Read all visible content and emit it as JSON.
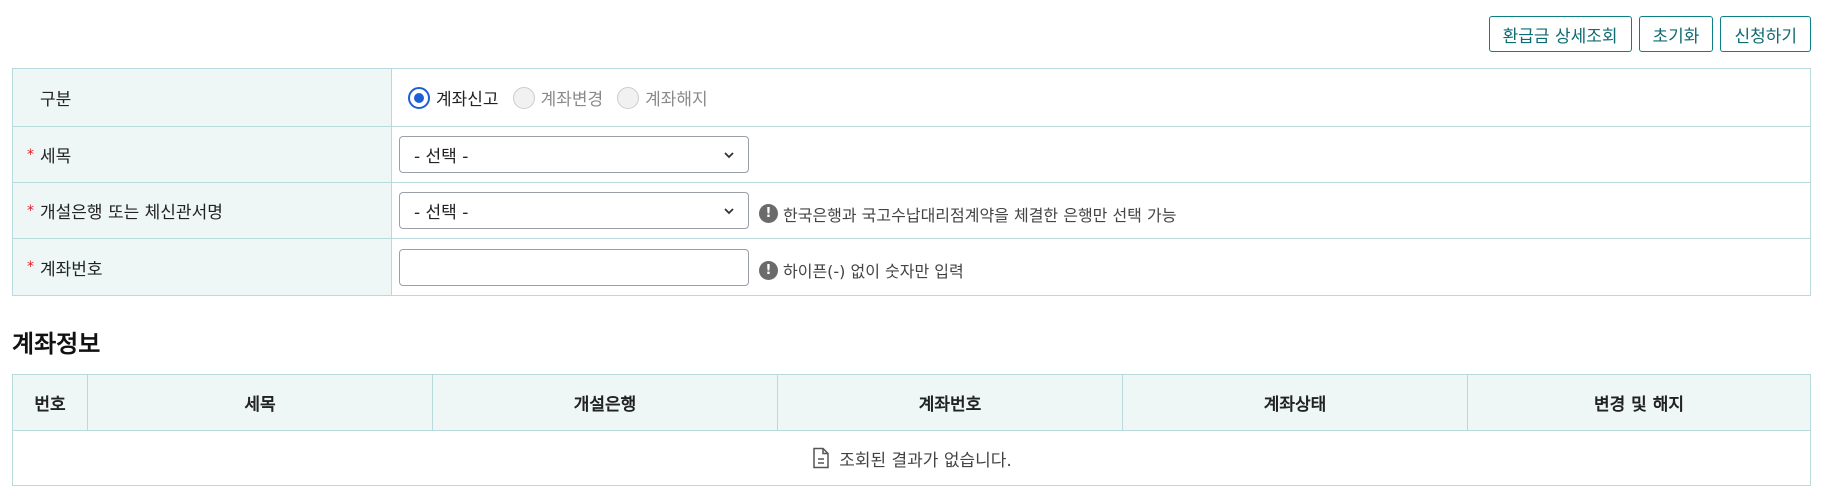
{
  "toolbar": {
    "refund_detail": "환급금 상세조회",
    "reset": "초기화",
    "apply": "신청하기"
  },
  "form": {
    "rows": {
      "category": {
        "label": "구분",
        "required": false
      },
      "tax_item": {
        "label": "세목",
        "required": true
      },
      "bank": {
        "label": "개설은행 또는 체신관서명",
        "required": true
      },
      "account": {
        "label": "계좌번호",
        "required": true
      }
    },
    "required_mark": "*",
    "radios": {
      "report": {
        "label": "계좌신고",
        "checked": true
      },
      "change": {
        "label": "계좌변경",
        "checked": false
      },
      "cancel": {
        "label": "계좌해지",
        "checked": false
      }
    },
    "tax_item_select": "- 선택 -",
    "bank_select": "- 선택 -",
    "bank_hint": "한국은행과 국고수납대리점계약을 체결한 은행만 선택 가능",
    "account_value": "",
    "account_hint": "하이픈(-) 없이 숫자만 입력",
    "hint_icon_glyph": "!"
  },
  "account_info": {
    "title": "계좌정보",
    "columns": [
      "번호",
      "세목",
      "개설은행",
      "계좌번호",
      "계좌상태",
      "변경 및 해지"
    ],
    "empty_message": "조회된 결과가 없습니다."
  },
  "colors": {
    "accent": "#0d7f86",
    "header_bg": "#eef7f6",
    "border": "#b9dadd",
    "radio_checked": "#1f5fd6",
    "required": "#d8202a"
  }
}
